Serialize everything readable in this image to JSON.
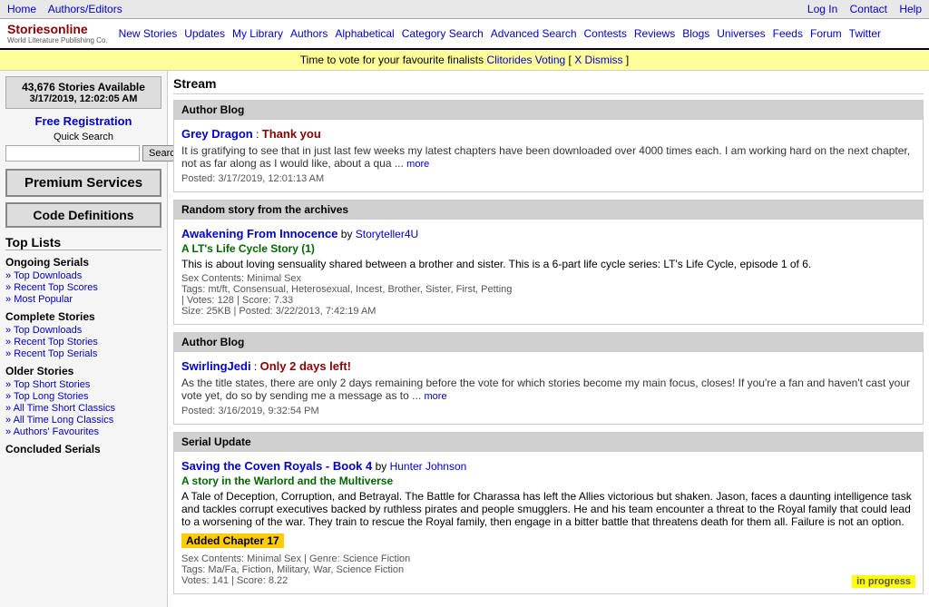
{
  "top_nav": {
    "left": {
      "links": [
        {
          "label": "Home",
          "href": "#"
        },
        {
          "label": "Authors/Editors",
          "href": "#"
        }
      ]
    },
    "right": {
      "links": [
        {
          "label": "Log In",
          "href": "#"
        },
        {
          "label": "Contact",
          "href": "#"
        },
        {
          "label": "Help",
          "href": "#"
        }
      ]
    }
  },
  "logo": {
    "title": "Storiesonline",
    "subtitle": "World Literature Publishing Co."
  },
  "main_nav": {
    "links": [
      {
        "label": "New Stories"
      },
      {
        "label": "Updates"
      },
      {
        "label": "My Library"
      },
      {
        "label": "Authors"
      },
      {
        "label": "Alphabetical"
      },
      {
        "label": "Category Search"
      },
      {
        "label": "Advanced Search"
      },
      {
        "label": "Contests"
      },
      {
        "label": "Reviews"
      },
      {
        "label": "Blogs"
      },
      {
        "label": "Universes"
      },
      {
        "label": "Feeds"
      },
      {
        "label": "Forum"
      },
      {
        "label": "Twitter"
      }
    ]
  },
  "alert_bar": {
    "text": "Time to vote for your favourite finalists",
    "link_text": "Clitorides Voting",
    "dismiss_text": "X Dismiss"
  },
  "sidebar": {
    "stories_count": "43,676 Stories Available",
    "stories_date": "3/17/2019, 12:02:05 AM",
    "free_registration": "Free Registration",
    "quick_search_label": "Quick Search",
    "search_placeholder": "",
    "search_btn": "Search",
    "premium_services": "Premium Services",
    "code_definitions": "Code Definitions",
    "top_lists": "Top Lists",
    "sections": [
      {
        "title": "Ongoing Serials",
        "links": [
          {
            "label": "Top Downloads"
          },
          {
            "label": "Recent Top Scores"
          },
          {
            "label": "Most Popular"
          }
        ]
      },
      {
        "title": "Complete Stories",
        "links": [
          {
            "label": "Top Downloads"
          },
          {
            "label": "Recent Top Stories"
          },
          {
            "label": "Recent Top Serials"
          }
        ]
      },
      {
        "title": "Older Stories",
        "links": [
          {
            "label": "Top Short Stories"
          },
          {
            "label": "Top Long Stories"
          },
          {
            "label": "All Time Short Classics"
          },
          {
            "label": "All Time Long Classics"
          },
          {
            "label": "Authors' Favourites"
          }
        ]
      },
      {
        "title": "Concluded Serials",
        "links": []
      }
    ]
  },
  "content": {
    "stream_header": "Stream",
    "sections": [
      {
        "type": "author_blog",
        "header": "Author Blog",
        "author": "Grey Dragon",
        "title": "Thank you",
        "body": "It is gratifying to see that in just last few weeks my latest chapters have been downloaded over 4000 times each. I am working hard on the next chapter, not as far along as I would like, about a qua ...",
        "more": "more",
        "date": "Posted: 3/17/2019, 12:01:13 AM"
      },
      {
        "type": "random_story",
        "header": "Random story from the archives",
        "story_title": "Awakening From Innocence",
        "by": "by",
        "story_author": "Storyteller4U",
        "subtitle": "A LT's Life Cycle Story",
        "subtitle_num": "(1)",
        "desc": "This is about loving sensuality shared between a brother and sister. This is a 6-part life cycle series: LT's Life Cycle, episode 1 of 6.",
        "sex_contents": "Sex Contents: Minimal Sex",
        "tags": "Tags: mt/ft, Consensual, Heterosexual, Incest, Brother, Sister, First, Petting",
        "votes": "128",
        "score": "7.33",
        "size": "25KB",
        "posted": "3/22/2013, 7:42:19 AM"
      },
      {
        "type": "author_blog",
        "header": "Author Blog",
        "author": "SwirlingJedi",
        "title": "Only 2 days left!",
        "body": "As the title states, there are only 2 days remaining before the vote for which stories become my main focus, closes! If you're a fan and haven't cast your vote yet, do so by sending me a message as to ...",
        "more": "more",
        "date": "Posted: 3/16/2019, 9:32:54 PM"
      },
      {
        "type": "serial_update",
        "header": "Serial Update",
        "story_title": "Saving the Coven Royals - Book 4",
        "by": "by",
        "story_author": "Hunter Johnson",
        "subtitle": "A story in the Warlord and the Multiverse",
        "desc": "A Tale of Deception, Corruption, and Betrayal. The Battle for Charassa has left the Allies victorious but shaken. Jason, faces a daunting intelligence task and tackles corrupt executives backed by ruthless pirates and people smugglers. He and his team encounter a threat to the Royal family that could lead to a worsening of the war. They train to rescue the Royal family, then engage in a bitter battle that threatens death for them all. Failure is not an option.",
        "added_chapter": "Added Chapter 17",
        "sex_contents": "Sex Contents: Minimal Sex | Genre: Science Fiction",
        "tags": "Tags: Ma/Fa, Fiction, Military, War, Science Fiction",
        "votes": "141",
        "score": "8.22",
        "in_progress": "in progress"
      }
    ]
  }
}
